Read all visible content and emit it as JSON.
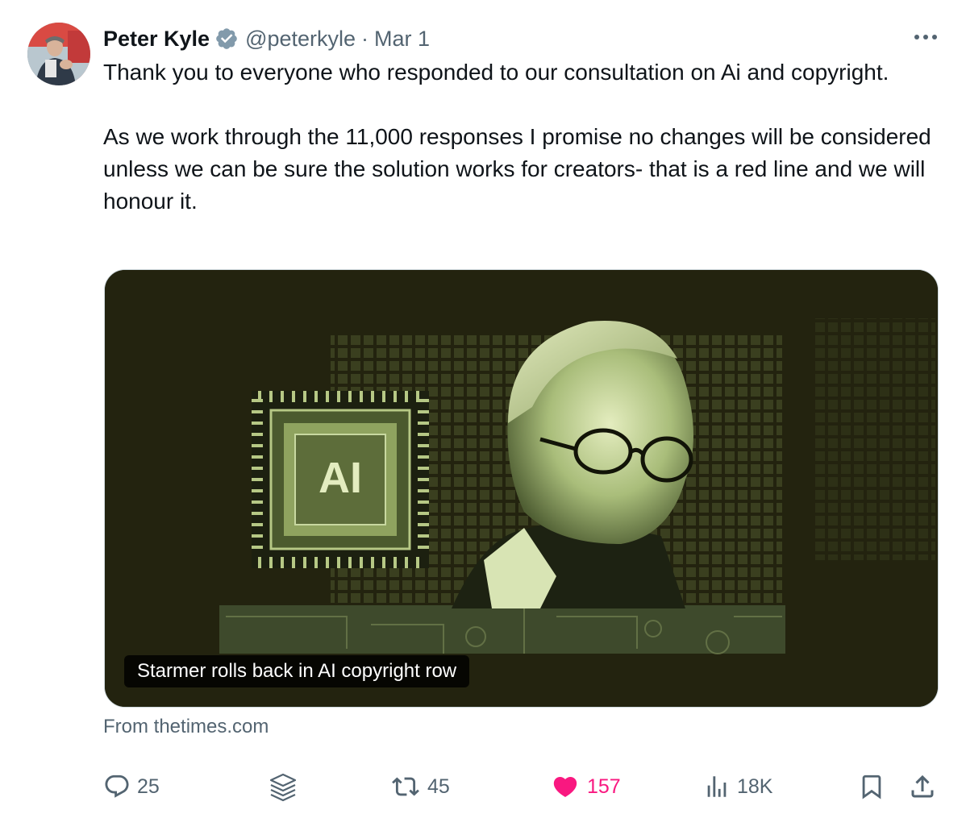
{
  "tweet": {
    "author_name": "Peter Kyle",
    "handle": "@peterkyle",
    "separator": "·",
    "date": "Mar 1",
    "paragraphs": [
      "Thank you to everyone who responded to our consultation on Ai and copyright.",
      "As we work through the 11,000 responses I promise no changes will be considered unless we can be sure the solution works for creators- that is a red line and we will honour it."
    ]
  },
  "card": {
    "chip_label": "AI",
    "headline": "Starmer rolls back in AI copyright row",
    "source": "From thetimes.com"
  },
  "actions": {
    "replies": "25",
    "retweets": "45",
    "likes": "157",
    "views": "18K",
    "liked": true
  },
  "colors": {
    "text": "#0f1419",
    "secondary": "#536471",
    "verified": "#829aab",
    "like": "#f91880",
    "card_bg": "#23230f",
    "card_green": "#c8d8a0"
  },
  "icons": [
    "verified-badge-icon",
    "more-icon",
    "reply-icon",
    "grok-icon",
    "retweet-icon",
    "heart-icon",
    "views-icon",
    "bookmark-icon",
    "share-icon"
  ]
}
